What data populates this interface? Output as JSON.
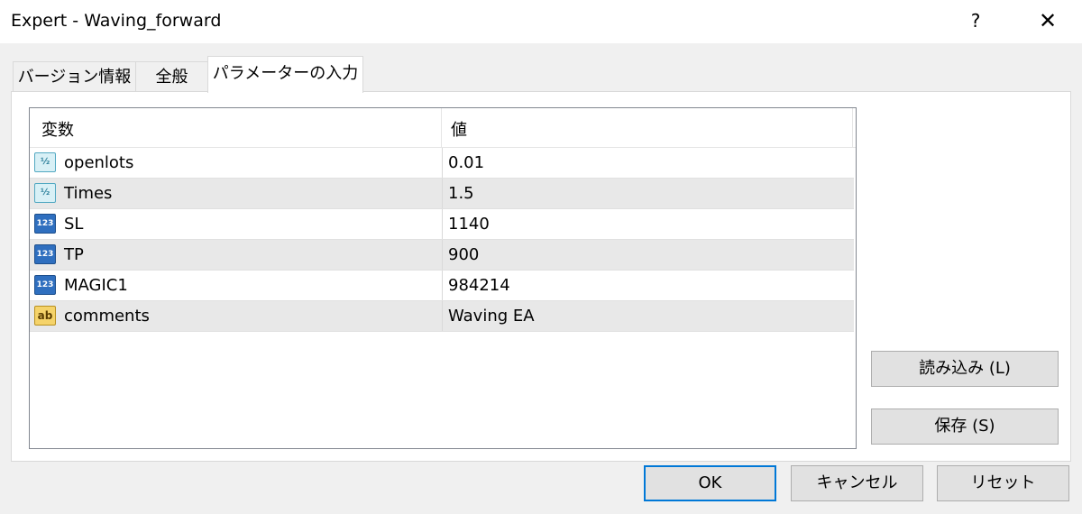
{
  "window": {
    "title": "Expert - Waving_forward",
    "help_label": "?",
    "close_label": "✕"
  },
  "tabs": [
    {
      "label": "バージョン情報",
      "active": false
    },
    {
      "label": "全般",
      "active": false
    },
    {
      "label": "パラメーターの入力",
      "active": true
    }
  ],
  "params_table": {
    "columns": [
      "変数",
      "値"
    ],
    "rows": [
      {
        "icon": "double-type-icon",
        "icon_text": "½",
        "name": "openlots",
        "value": "0.01"
      },
      {
        "icon": "double-type-icon",
        "icon_text": "½",
        "name": "Times",
        "value": "1.5"
      },
      {
        "icon": "int-type-icon",
        "icon_text": "123",
        "name": "SL",
        "value": "1140"
      },
      {
        "icon": "int-type-icon",
        "icon_text": "123",
        "name": "TP",
        "value": "900"
      },
      {
        "icon": "int-type-icon",
        "icon_text": "123",
        "name": "MAGIC1",
        "value": "984214"
      },
      {
        "icon": "string-type-icon",
        "icon_text": "ab",
        "name": "comments",
        "value": "Waving EA"
      }
    ]
  },
  "side_buttons": {
    "load_label": "読み込み (L)",
    "save_label": "保存 (S)"
  },
  "footer_buttons": {
    "ok_label": "OK",
    "cancel_label": "キャンセル",
    "reset_label": "リセット"
  },
  "colors": {
    "accent": "#0078d7",
    "row_alt": "#e8e8e8"
  }
}
